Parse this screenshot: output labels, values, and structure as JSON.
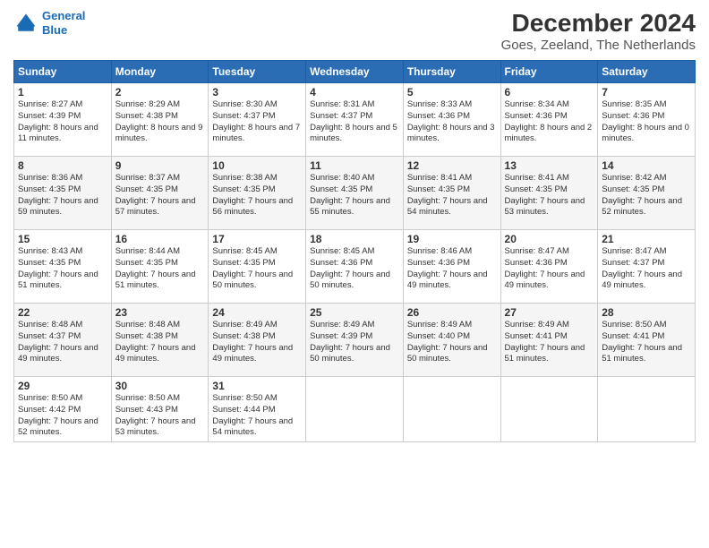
{
  "header": {
    "logo_line1": "General",
    "logo_line2": "Blue",
    "title": "December 2024",
    "subtitle": "Goes, Zeeland, The Netherlands"
  },
  "weekdays": [
    "Sunday",
    "Monday",
    "Tuesday",
    "Wednesday",
    "Thursday",
    "Friday",
    "Saturday"
  ],
  "weeks": [
    [
      {
        "day": "1",
        "sunrise": "8:27 AM",
        "sunset": "4:39 PM",
        "daylight": "8 hours and 11 minutes."
      },
      {
        "day": "2",
        "sunrise": "8:29 AM",
        "sunset": "4:38 PM",
        "daylight": "8 hours and 9 minutes."
      },
      {
        "day": "3",
        "sunrise": "8:30 AM",
        "sunset": "4:37 PM",
        "daylight": "8 hours and 7 minutes."
      },
      {
        "day": "4",
        "sunrise": "8:31 AM",
        "sunset": "4:37 PM",
        "daylight": "8 hours and 5 minutes."
      },
      {
        "day": "5",
        "sunrise": "8:33 AM",
        "sunset": "4:36 PM",
        "daylight": "8 hours and 3 minutes."
      },
      {
        "day": "6",
        "sunrise": "8:34 AM",
        "sunset": "4:36 PM",
        "daylight": "8 hours and 2 minutes."
      },
      {
        "day": "7",
        "sunrise": "8:35 AM",
        "sunset": "4:36 PM",
        "daylight": "8 hours and 0 minutes."
      }
    ],
    [
      {
        "day": "8",
        "sunrise": "8:36 AM",
        "sunset": "4:35 PM",
        "daylight": "7 hours and 59 minutes."
      },
      {
        "day": "9",
        "sunrise": "8:37 AM",
        "sunset": "4:35 PM",
        "daylight": "7 hours and 57 minutes."
      },
      {
        "day": "10",
        "sunrise": "8:38 AM",
        "sunset": "4:35 PM",
        "daylight": "7 hours and 56 minutes."
      },
      {
        "day": "11",
        "sunrise": "8:40 AM",
        "sunset": "4:35 PM",
        "daylight": "7 hours and 55 minutes."
      },
      {
        "day": "12",
        "sunrise": "8:41 AM",
        "sunset": "4:35 PM",
        "daylight": "7 hours and 54 minutes."
      },
      {
        "day": "13",
        "sunrise": "8:41 AM",
        "sunset": "4:35 PM",
        "daylight": "7 hours and 53 minutes."
      },
      {
        "day": "14",
        "sunrise": "8:42 AM",
        "sunset": "4:35 PM",
        "daylight": "7 hours and 52 minutes."
      }
    ],
    [
      {
        "day": "15",
        "sunrise": "8:43 AM",
        "sunset": "4:35 PM",
        "daylight": "7 hours and 51 minutes."
      },
      {
        "day": "16",
        "sunrise": "8:44 AM",
        "sunset": "4:35 PM",
        "daylight": "7 hours and 51 minutes."
      },
      {
        "day": "17",
        "sunrise": "8:45 AM",
        "sunset": "4:35 PM",
        "daylight": "7 hours and 50 minutes."
      },
      {
        "day": "18",
        "sunrise": "8:45 AM",
        "sunset": "4:36 PM",
        "daylight": "7 hours and 50 minutes."
      },
      {
        "day": "19",
        "sunrise": "8:46 AM",
        "sunset": "4:36 PM",
        "daylight": "7 hours and 49 minutes."
      },
      {
        "day": "20",
        "sunrise": "8:47 AM",
        "sunset": "4:36 PM",
        "daylight": "7 hours and 49 minutes."
      },
      {
        "day": "21",
        "sunrise": "8:47 AM",
        "sunset": "4:37 PM",
        "daylight": "7 hours and 49 minutes."
      }
    ],
    [
      {
        "day": "22",
        "sunrise": "8:48 AM",
        "sunset": "4:37 PM",
        "daylight": "7 hours and 49 minutes."
      },
      {
        "day": "23",
        "sunrise": "8:48 AM",
        "sunset": "4:38 PM",
        "daylight": "7 hours and 49 minutes."
      },
      {
        "day": "24",
        "sunrise": "8:49 AM",
        "sunset": "4:38 PM",
        "daylight": "7 hours and 49 minutes."
      },
      {
        "day": "25",
        "sunrise": "8:49 AM",
        "sunset": "4:39 PM",
        "daylight": "7 hours and 50 minutes."
      },
      {
        "day": "26",
        "sunrise": "8:49 AM",
        "sunset": "4:40 PM",
        "daylight": "7 hours and 50 minutes."
      },
      {
        "day": "27",
        "sunrise": "8:49 AM",
        "sunset": "4:41 PM",
        "daylight": "7 hours and 51 minutes."
      },
      {
        "day": "28",
        "sunrise": "8:50 AM",
        "sunset": "4:41 PM",
        "daylight": "7 hours and 51 minutes."
      }
    ],
    [
      {
        "day": "29",
        "sunrise": "8:50 AM",
        "sunset": "4:42 PM",
        "daylight": "7 hours and 52 minutes."
      },
      {
        "day": "30",
        "sunrise": "8:50 AM",
        "sunset": "4:43 PM",
        "daylight": "7 hours and 53 minutes."
      },
      {
        "day": "31",
        "sunrise": "8:50 AM",
        "sunset": "4:44 PM",
        "daylight": "7 hours and 54 minutes."
      },
      null,
      null,
      null,
      null
    ]
  ]
}
